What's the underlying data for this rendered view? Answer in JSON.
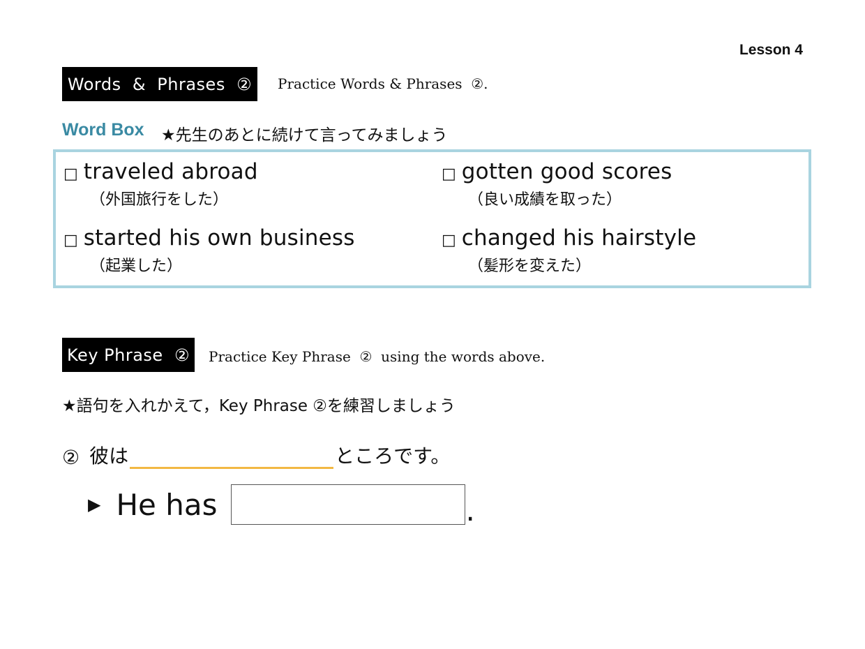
{
  "header": {
    "lesson": "Lesson 4"
  },
  "words_phrases": {
    "label": "Words  &  Phrases  ②",
    "note": "Practice Words & Phrases  ②."
  },
  "word_box": {
    "title": "Word Box",
    "instruction": "★先生のあとに続けて言ってみましょう",
    "checkbox_glyph": "□",
    "border_color": "#a9d4e0",
    "title_color": "#3a8aa3",
    "items": [
      {
        "en": "traveled abroad",
        "jp": "（外国旅行をした）"
      },
      {
        "en": "gotten good scores",
        "jp": "（良い成績を取った）"
      },
      {
        "en": "started his own business",
        "jp": "（起業した）"
      },
      {
        "en": "changed his hairstyle",
        "jp": "（髪形を変えた）"
      }
    ]
  },
  "key_phrase": {
    "label": "Key Phrase  ②",
    "note": "Practice Key Phrase  ②  using the words above.",
    "instruction": "★語句を入れかえて，Key Phrase ②を練習しましょう",
    "jp_number": "②",
    "jp_prefix": "彼は",
    "jp_suffix": "ところです。",
    "blank_color": "#f2b843",
    "arrow_icon": "▶",
    "en_prefix": "He has",
    "en_suffix": ".",
    "answer_value": ""
  }
}
